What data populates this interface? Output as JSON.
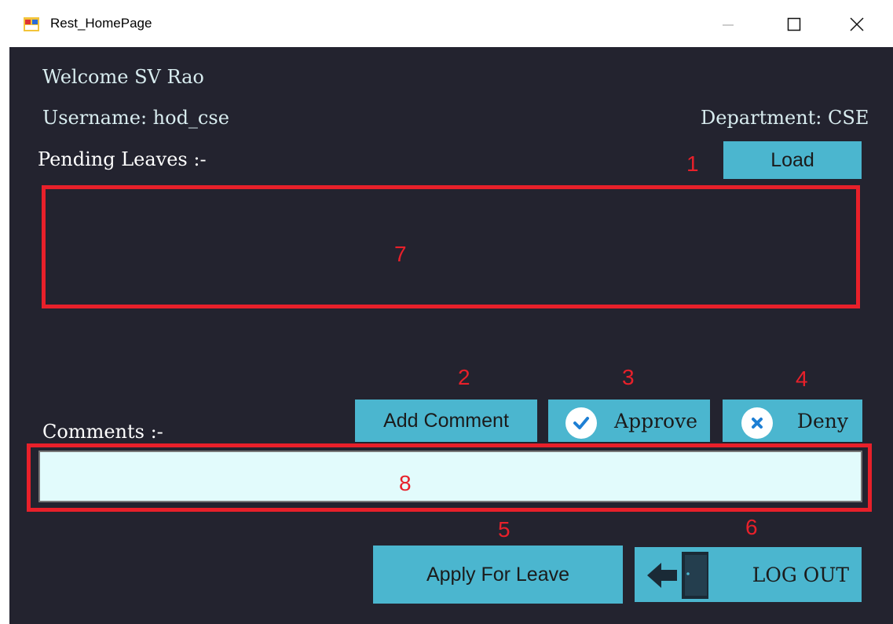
{
  "window": {
    "title": "Rest_HomePage",
    "app_icon": "windows-form-icon",
    "minimize_icon": "minimize-icon",
    "maximize_icon": "maximize-icon",
    "close_icon": "close-icon"
  },
  "header": {
    "welcome": "Welcome SV Rao",
    "username": "Username: hod_cse",
    "department": "Department: CSE"
  },
  "pending": {
    "label": "Pending Leaves :-",
    "load_button": "Load"
  },
  "actions": {
    "add_comment": "Add Comment",
    "approve": "Approve",
    "approve_icon": "check-icon",
    "deny": "Deny",
    "deny_icon": "x-icon"
  },
  "comments": {
    "label": "Comments :-",
    "value": ""
  },
  "bottom": {
    "apply_leave": "Apply For Leave",
    "logout": "LOG OUT",
    "logout_icon": "door-exit-icon"
  },
  "annotations": [
    "1",
    "2",
    "3",
    "4",
    "5",
    "6",
    "7",
    "8"
  ],
  "colors": {
    "background": "#23232f",
    "button": "#4bb6cf",
    "annotation": "#e8202a",
    "comment_field": "#e2fbfc"
  }
}
